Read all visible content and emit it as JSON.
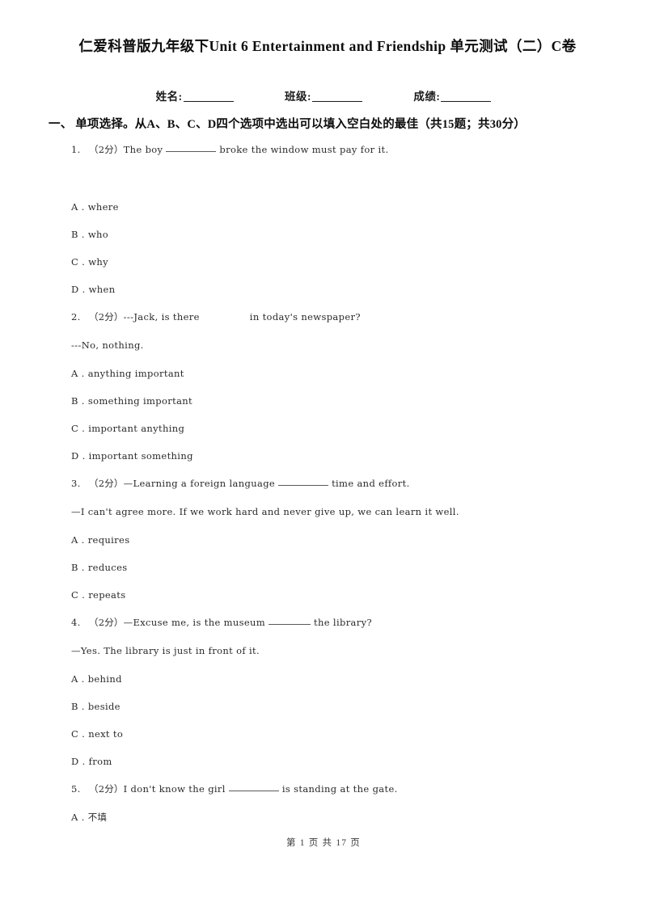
{
  "document": {
    "title": "仁爱科普版九年级下Unit 6 Entertainment and Friendship 单元测试（二）C卷"
  },
  "student_info": {
    "name_label": "姓名:",
    "class_label": "班级:",
    "score_label": "成绩:"
  },
  "section": {
    "heading": "一、 单项选择。从A、B、C、D四个选项中选出可以填入空白处的最佳（共15题；共30分）"
  },
  "questions": [
    {
      "number": "1.",
      "points": "（2分）",
      "text_before": "The boy",
      "blank": "underline",
      "text_after": "broke the window must pay for it.",
      "second_line": "",
      "options": [
        {
          "label": "A .",
          "text": "where"
        },
        {
          "label": "B .",
          "text": "who"
        },
        {
          "label": "C .",
          "text": "why"
        },
        {
          "label": "D .",
          "text": "when"
        }
      ]
    },
    {
      "number": "2.",
      "points": "（2分）",
      "text_before": "---Jack, is there",
      "blank": "gap",
      "text_after": "in today's newspaper?",
      "second_line": "---No, nothing.",
      "options": [
        {
          "label": "A .",
          "text": "anything important"
        },
        {
          "label": "B .",
          "text": "something important"
        },
        {
          "label": "C .",
          "text": "important anything"
        },
        {
          "label": "D .",
          "text": "important something"
        }
      ]
    },
    {
      "number": "3.",
      "points": "（2分）",
      "text_before": "—Learning a foreign language",
      "blank": "underline",
      "text_after": "time and effort.",
      "second_line": "—I can't agree more. If we work hard and never give up, we can learn it well.",
      "options": [
        {
          "label": "A .",
          "text": "requires"
        },
        {
          "label": "B .",
          "text": "reduces"
        },
        {
          "label": "C .",
          "text": "repeats"
        }
      ]
    },
    {
      "number": "4.",
      "points": "（2分）",
      "text_before": "—Excuse me, is the museum",
      "blank": "underline-short",
      "text_after": "the library?",
      "second_line": "—Yes. The library is just in front of it.",
      "options": [
        {
          "label": "A .",
          "text": "behind"
        },
        {
          "label": "B .",
          "text": "beside"
        },
        {
          "label": "C .",
          "text": "next to"
        },
        {
          "label": "D .",
          "text": "from"
        }
      ]
    },
    {
      "number": "5.",
      "points": "（2分）",
      "text_before": "I don't know the girl",
      "blank": "underline",
      "text_after": "is standing at the gate.",
      "second_line": "",
      "options": [
        {
          "label": "A .",
          "text": "不填"
        }
      ]
    }
  ],
  "footer": {
    "text": "第 1 页 共 17 页"
  }
}
